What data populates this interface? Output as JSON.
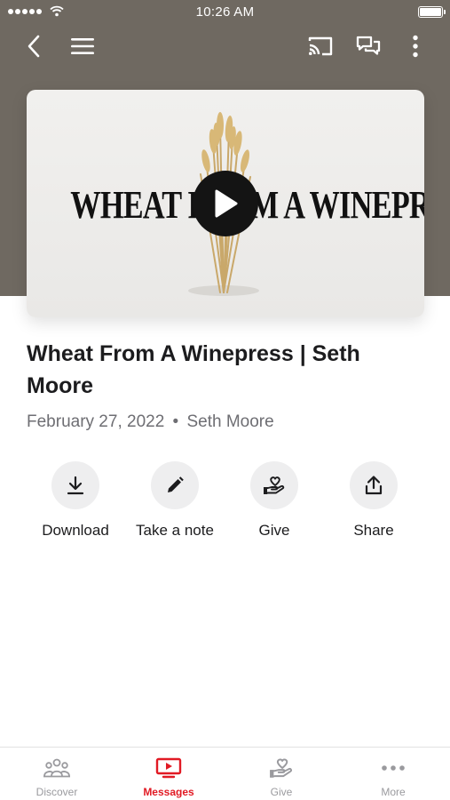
{
  "status_bar": {
    "time": "10:26 AM"
  },
  "video": {
    "title_text": "WHEAT FROM A WINEPRESS",
    "play_icon": "play-icon"
  },
  "message": {
    "title": "Wheat From A Winepress | Seth Moore",
    "date": "February 27, 2022",
    "separator": "•",
    "speaker": "Seth Moore"
  },
  "actions": [
    {
      "label": "Download",
      "icon": "download-icon"
    },
    {
      "label": "Take a note",
      "icon": "pencil-icon"
    },
    {
      "label": "Give",
      "icon": "heart-hand-icon"
    },
    {
      "label": "Share",
      "icon": "share-icon"
    }
  ],
  "tabs": [
    {
      "label": "Discover",
      "icon": "people-icon",
      "active": false
    },
    {
      "label": "Messages",
      "icon": "tv-play-icon",
      "active": true
    },
    {
      "label": "Give",
      "icon": "heart-hand-icon",
      "active": false
    },
    {
      "label": "More",
      "icon": "dots-icon",
      "active": false
    }
  ],
  "colors": {
    "accent": "#e11a24",
    "header_bg": "#6f6961"
  }
}
